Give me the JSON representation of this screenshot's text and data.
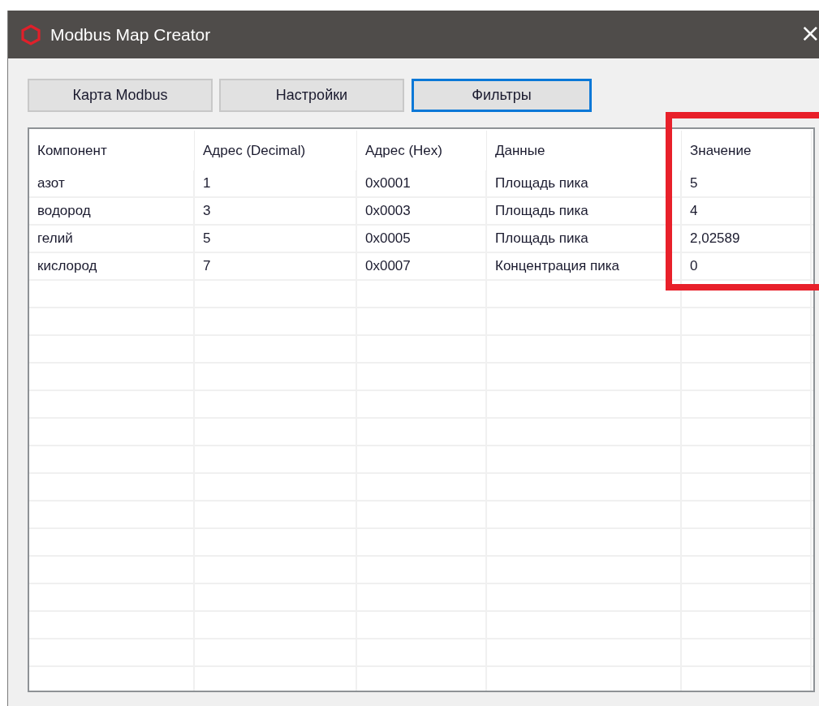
{
  "window": {
    "title": "Modbus Map Creator",
    "close": "×"
  },
  "tabs": [
    {
      "label": "Карта Modbus",
      "selected": false
    },
    {
      "label": "Настройки",
      "selected": false
    },
    {
      "label": "Фильтры",
      "selected": true
    }
  ],
  "table": {
    "columns": [
      "Компонент",
      "Адрес (Decimal)",
      "Адрес (Hex)",
      "Данные",
      "Значение"
    ],
    "rows": [
      [
        "азот",
        "1",
        "0x0001",
        "Площадь пика",
        "5"
      ],
      [
        "водород",
        "3",
        "0x0003",
        "Площадь пика",
        "4"
      ],
      [
        "гелий",
        "5",
        "0x0005",
        "Площадь пика",
        "2,02589"
      ],
      [
        "кислород",
        "7",
        "0x0007",
        "Концентрация пика",
        "0"
      ]
    ]
  }
}
